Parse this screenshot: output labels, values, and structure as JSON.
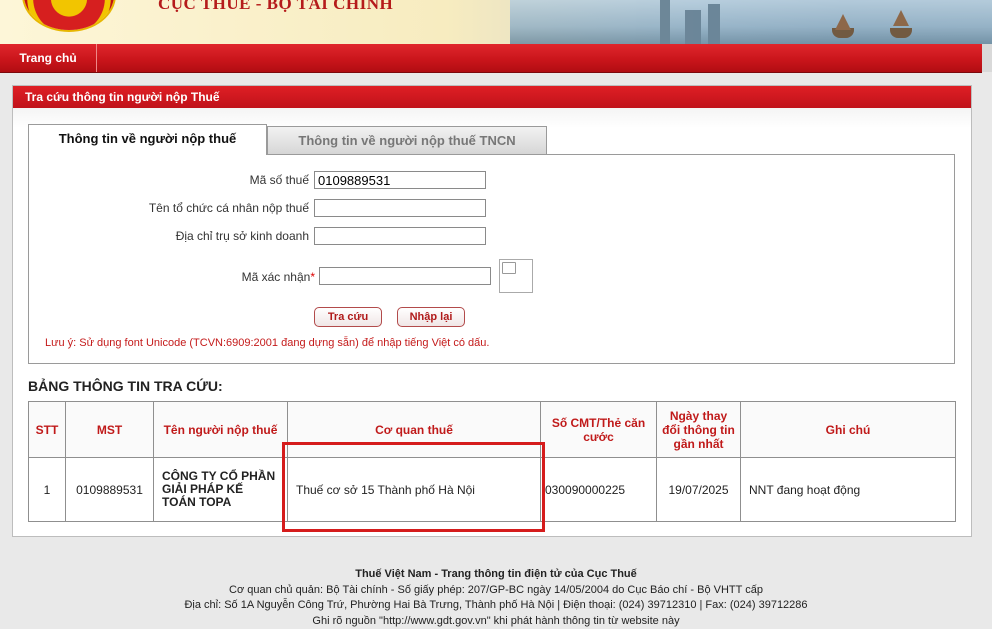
{
  "header": {
    "site_title": "CỤC THUẾ - BỘ TÀI CHÍNH"
  },
  "nav": {
    "home": "Trang chủ"
  },
  "panel": {
    "title": "Tra cứu thông tin người nộp Thuế"
  },
  "tabs": [
    {
      "label": "Thông tin về người nộp thuế",
      "active": true
    },
    {
      "label": "Thông tin về người nộp thuế TNCN",
      "active": false
    }
  ],
  "form": {
    "tax_id_label": "Mã số thuế",
    "tax_id_value": "0109889531",
    "name_label": "Tên tổ chức cá nhân nộp thuế",
    "name_value": "",
    "address_label": "Địa chỉ trụ sở kinh doanh",
    "address_value": "",
    "captcha_label": "Mã xác nhận",
    "captcha_required": "*",
    "captcha_value": "",
    "search_button": "Tra cứu",
    "reset_button": "Nhập lại",
    "note": "Lưu ý: Sử dụng font Unicode (TCVN:6909:2001 đang dựng sẵn) để nhập tiếng Việt có dấu."
  },
  "results": {
    "title": "BẢNG THÔNG TIN TRA CỨU:",
    "columns": [
      "STT",
      "MST",
      "Tên người nộp thuế",
      "Cơ quan thuế",
      "Số CMT/Thẻ căn cước",
      "Ngày thay đổi thông tin gần nhất",
      "Ghi chú"
    ],
    "rows": [
      {
        "stt": "1",
        "mst": "0109889531",
        "name": "CÔNG TY CỔ PHẦN GIẢI PHÁP KẾ TOÁN TOPA",
        "tax_office": "Thuế cơ sở 15 Thành phố Hà Nội",
        "id_card": "030090000225",
        "last_changed": "19/07/2025",
        "note": "NNT đang hoạt động"
      }
    ]
  },
  "footer": {
    "line1": "Thuế Việt Nam - Trang thông tin điện tử của Cục Thuế",
    "line2": "Cơ quan chủ quản: Bộ Tài chính - Số giấy phép: 207/GP-BC ngày 14/05/2004 do Cục Báo chí - Bộ VHTT cấp",
    "line3": "Địa chỉ: Số 1A Nguyễn Công Trứ, Phường Hai Bà Trưng, Thành phố Hà Nội | Điện thoại: (024) 39712310 | Fax: (024) 39712286",
    "line4": "Ghi rõ nguồn \"http://www.gdt.gov.vn\" khi phát hành thông tin từ website này"
  },
  "colors": {
    "brand_red": "#c8141a",
    "label_red": "#c01a1a",
    "highlight": "#d51c1c"
  }
}
